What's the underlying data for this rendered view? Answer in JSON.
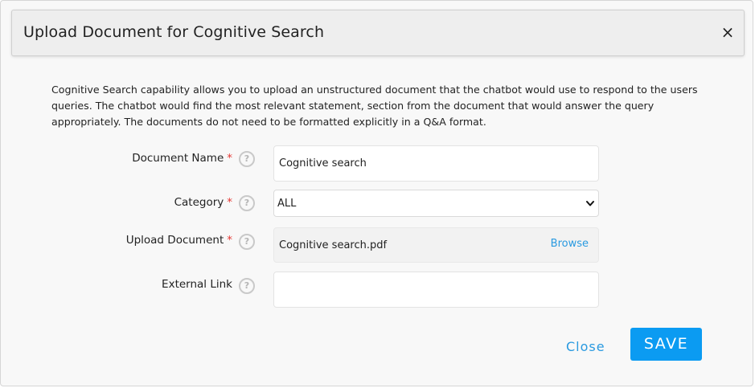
{
  "modal": {
    "title": "Upload Document for Cognitive Search",
    "close_icon": "close-icon",
    "description": "Cognitive Search capability allows you to upload an unstructured document that the chatbot would use to respond to the users queries. The chatbot would find the most relevant statement, section from the document that would answer the query appropriately. The documents do not need to be formatted explicitly in a Q&A format."
  },
  "form": {
    "document_name": {
      "label": "Document Name",
      "required": "*",
      "value": "Cognitive search"
    },
    "category": {
      "label": "Category",
      "required": "*",
      "selected": "ALL"
    },
    "upload_document": {
      "label": "Upload Document",
      "required": "*",
      "file_name": "Cognitive search.pdf",
      "browse_label": "Browse"
    },
    "external_link": {
      "label": "External Link",
      "value": ""
    },
    "help_glyph": "?"
  },
  "actions": {
    "close_label": "Close",
    "save_label": "SAVE"
  },
  "colors": {
    "accent": "#0b9bf2",
    "link": "#2a9ae0",
    "required": "#e53935"
  }
}
